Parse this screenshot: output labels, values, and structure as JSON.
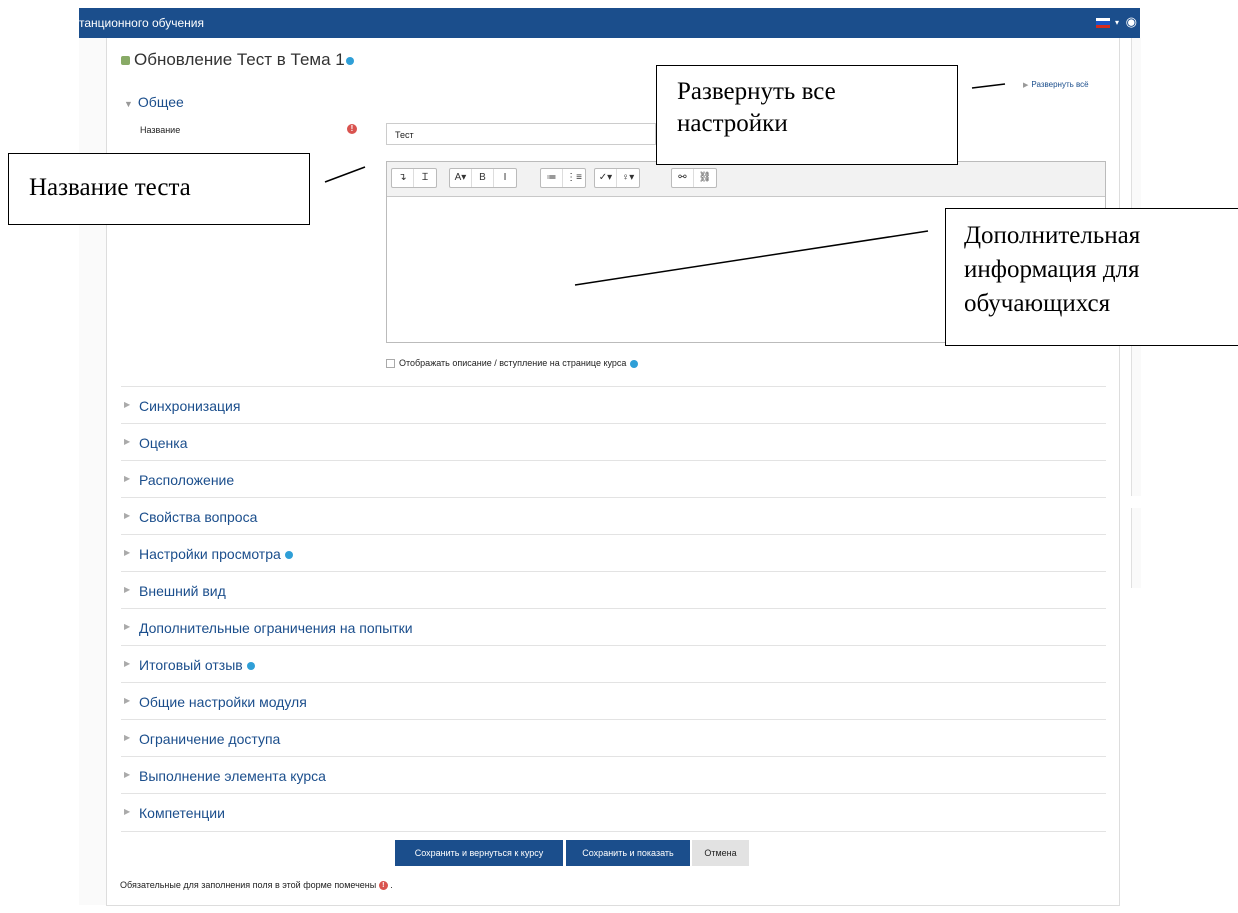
{
  "header": {
    "site_name": "танционного обучения"
  },
  "page": {
    "title": "Обновление Тест в Тема 1",
    "expand_all": "Развернуть всё"
  },
  "general": {
    "section_label": "Общее",
    "name_label": "Название",
    "name_value": "Тест",
    "show_description_label": "Отображать описание / вступление на странице курса"
  },
  "editor_toolbar": [
    [
      "↴",
      "Ɪ"
    ],
    [
      "A▾",
      "B",
      "I"
    ],
    [
      "≔",
      "⋮≡"
    ],
    [
      "✓▾",
      "♀▾"
    ],
    [
      "⚯",
      "⛓"
    ]
  ],
  "sections": [
    {
      "label": "Синхронизация",
      "help": false
    },
    {
      "label": "Оценка",
      "help": false
    },
    {
      "label": "Расположение",
      "help": false
    },
    {
      "label": "Свойства вопроса",
      "help": false
    },
    {
      "label": "Настройки просмотра",
      "help": true
    },
    {
      "label": "Внешний вид",
      "help": false
    },
    {
      "label": "Дополнительные ограничения на попытки",
      "help": false
    },
    {
      "label": "Итоговый отзыв",
      "help": true
    },
    {
      "label": "Общие настройки модуля",
      "help": false
    },
    {
      "label": "Ограничение доступа",
      "help": false
    },
    {
      "label": "Выполнение элемента курса",
      "help": false
    },
    {
      "label": "Компетенции",
      "help": false
    }
  ],
  "buttons": {
    "save_return": "Сохранить и вернуться к курсу",
    "save_display": "Сохранить и показать",
    "cancel": "Отмена"
  },
  "required_note": "Обязательные для заполнения поля в этой форме помечены",
  "required_note_end": ".",
  "callouts": {
    "expand": [
      "Развернуть все",
      "настройки"
    ],
    "name": "Название теста",
    "info": [
      "Дополнительная",
      "информация для",
      "обучающихся"
    ]
  },
  "colors": {
    "header": "#1b4e8c",
    "link": "#1b4e8c",
    "required": "#d9534f",
    "help": "#2f9fd7"
  }
}
